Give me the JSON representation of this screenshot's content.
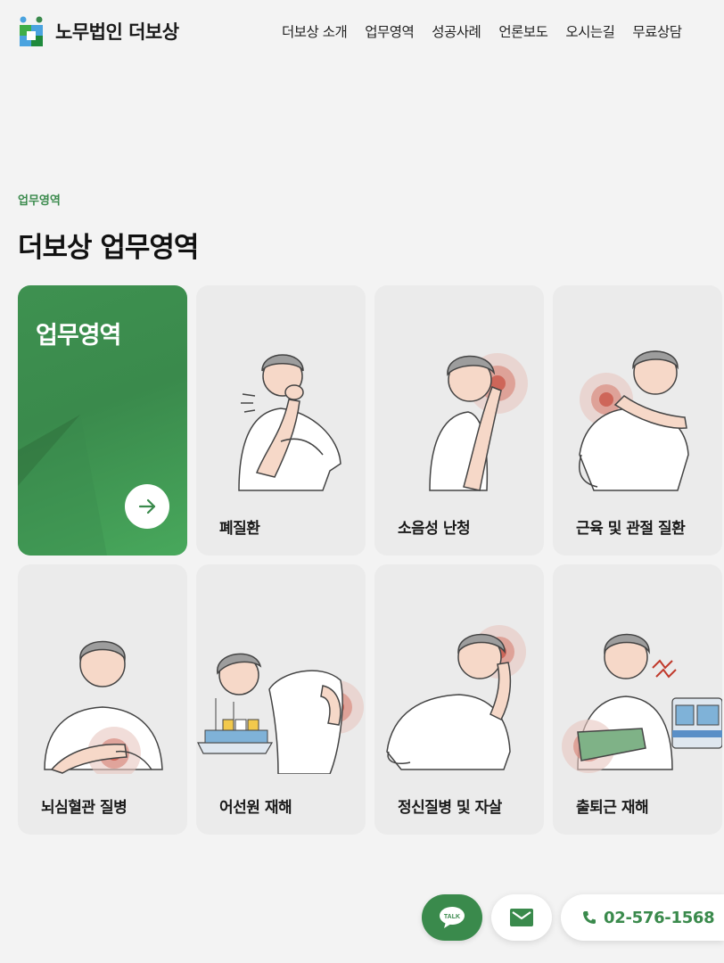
{
  "brand": {
    "name": "노무법인 더보상",
    "accent": "#3a8a4c"
  },
  "nav": [
    {
      "label": "더보상 소개"
    },
    {
      "label": "업무영역"
    },
    {
      "label": "성공사례"
    },
    {
      "label": "언론보도"
    },
    {
      "label": "오시는길"
    },
    {
      "label": "무료상담"
    }
  ],
  "section": {
    "eyebrow": "업무영역",
    "title": "더보상 업무영역"
  },
  "feature_card": {
    "title": "업무영역",
    "icon": "arrow-right-icon"
  },
  "cards": [
    {
      "label": "폐질환",
      "icon": "coughing-person-illustration"
    },
    {
      "label": "소음성 난청",
      "icon": "ear-pain-illustration"
    },
    {
      "label": "근육 및 관절 질환",
      "icon": "shoulder-pain-illustration"
    },
    {
      "label": "뇌심혈관 질병",
      "icon": "chest-pain-illustration"
    },
    {
      "label": "어선원 재해",
      "icon": "fishing-boat-back-pain-illustration"
    },
    {
      "label": "정신질병 및 자살",
      "icon": "headache-illustration"
    },
    {
      "label": "출퇴근 재해",
      "icon": "commute-injury-illustration"
    }
  ],
  "contact": {
    "talk_label": "TALK",
    "phone": "02-576-1568"
  }
}
